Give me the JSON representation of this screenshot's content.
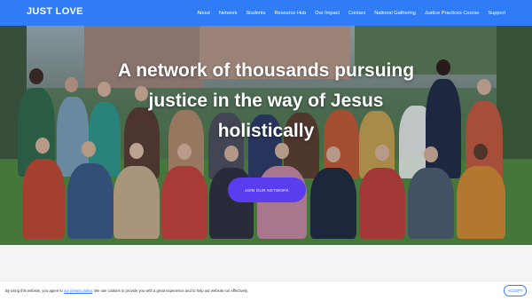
{
  "header": {
    "logo": "JUST LOVE",
    "nav": [
      "About",
      "Network",
      "Students",
      "Resource Hub",
      "Our Impact",
      "Contact",
      "National Gathering",
      "Justice Practices Course",
      "Support"
    ]
  },
  "hero": {
    "title_lines": [
      "A network of thousands pursuing",
      "justice in the way of Jesus",
      "holistically"
    ],
    "cta_label": "JOIN OUR NETWORK"
  },
  "cookie": {
    "text_before": "By using this website, you agree to ",
    "link": "our privacy policy",
    "text_after": ". We use cookies to provide you with a great experience and to help our website run effectively.",
    "accept_label": "ACCEPT"
  },
  "colors": {
    "brand": "#2f7cf6",
    "cta": "#5b3df0"
  }
}
